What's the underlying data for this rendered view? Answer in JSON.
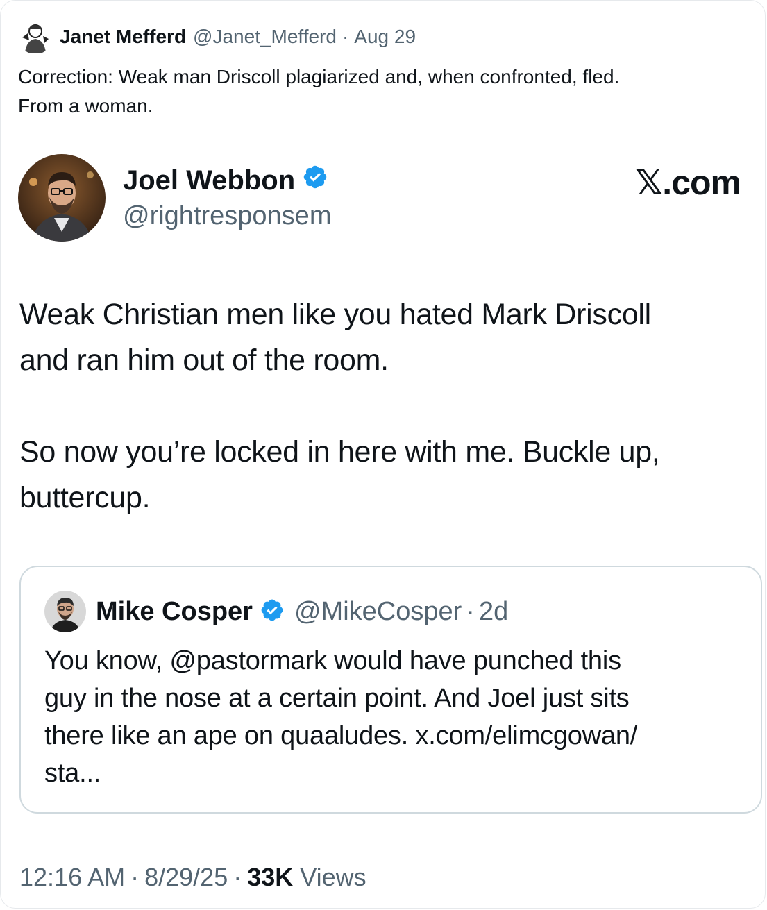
{
  "outer_tweet": {
    "author_name": "Janet Mefferd",
    "author_handle": "@Janet_Mefferd",
    "separator": "·",
    "date": "Aug 29",
    "text": "Correction: Weak man Driscoll plagiarized and, when confronted, fled.\nFrom a woman."
  },
  "embedded_tweet": {
    "author_name": "Joel Webbon",
    "author_handle": "@rightresponsem",
    "watermark": "𝕏.com",
    "text": "Weak Christian men like you hated Mark Driscoll\nand ran him out of the room.\n\nSo now you’re locked in here with me. Buckle up,\nbuttercup."
  },
  "quoted_tweet": {
    "author_name": "Mike Cosper",
    "author_handle": "@MikeCosper",
    "separator": "·",
    "time": "2d",
    "text": "You know, @pastormark would have punched this\nguy in the nose at a certain point. And Joel just sits\nthere like an ape on quaaludes. x.com/elimcgowan/\nsta..."
  },
  "footer": {
    "time": "12:16 AM",
    "separator": "·",
    "date": "8/29/25",
    "views_count": "33K",
    "views_label": "Views"
  },
  "colors": {
    "text_primary": "#0f1419",
    "text_secondary": "#536471",
    "verified_blue": "#1d9bf0",
    "border": "#cfd9de"
  },
  "icons": {
    "author_avatar": "sketch-portrait-avatar",
    "verified_badge": "verified-badge-icon"
  }
}
